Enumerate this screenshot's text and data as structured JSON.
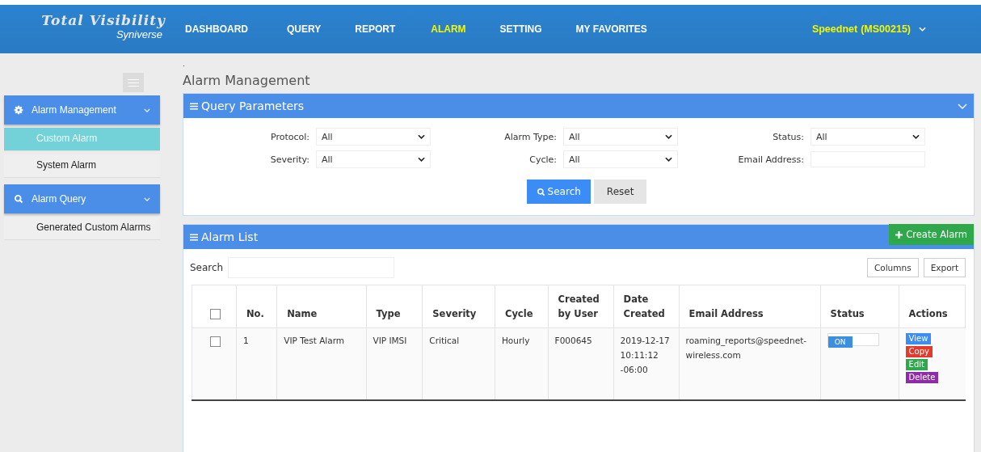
{
  "logo": {
    "title": "Total Visibility",
    "subtitle": "Syniverse"
  },
  "nav": [
    {
      "label": "DASHBOARD",
      "selected": false
    },
    {
      "label": "QUERY",
      "selected": false
    },
    {
      "label": "REPORT",
      "selected": false
    },
    {
      "label": "ALARM",
      "selected": true
    },
    {
      "label": "SETTING",
      "selected": false
    },
    {
      "label": "MY FAVORITES",
      "selected": false
    }
  ],
  "account": {
    "name": "Speednet",
    "code": "(MS00215)"
  },
  "sidebar": [
    {
      "label": "Alarm Management",
      "kind": "settings",
      "expanded": true,
      "children": [
        {
          "label": "Custom Alarm",
          "selected": true
        },
        {
          "label": "System Alarm",
          "selected": false
        }
      ]
    },
    {
      "label": "Alarm Query",
      "kind": "query",
      "expanded": true,
      "children": [
        {
          "label": "Generated Custom Alarms",
          "selected": false
        }
      ]
    }
  ],
  "breadcrumb": ".",
  "page_title": "Alarm Management",
  "query": {
    "title": "Query Parameters",
    "fields": [
      {
        "label": "Protocol:",
        "kind": "select",
        "value": "All"
      },
      {
        "label": "Alarm Type:",
        "kind": "select",
        "value": "All"
      },
      {
        "label": "Status:",
        "kind": "select",
        "value": "All"
      },
      {
        "label": "Severity:",
        "kind": "select",
        "value": "All"
      },
      {
        "label": "Cycle:",
        "kind": "select",
        "value": "All"
      },
      {
        "label": "Email Address:",
        "kind": "text"
      }
    ],
    "search_button": "Search",
    "reset_button": "Reset"
  },
  "alarm_list": {
    "title": "Alarm List",
    "create_button": "Create Alarm",
    "search_label": "Search",
    "columns_button": "Columns",
    "export_button": "Export",
    "all_checked": false,
    "columns": [
      "No.",
      "Name",
      "Type",
      "Severity",
      "Cycle",
      "Created by User",
      "Date Created",
      "Email Address",
      "Status",
      "Actions"
    ],
    "rows": [
      {
        "checked": false,
        "cells": [
          "1",
          "VIP Test Alarm",
          "VIP IMSI",
          "Critical",
          "Hourly",
          "F000645",
          "2019-12-17 10:11:12 -06:00",
          "roaming_reports@speednet-wireless.com"
        ],
        "status": {
          "label": "ON",
          "on": true
        },
        "actions": [
          {
            "label": "View",
            "kind": "view"
          },
          {
            "label": "Copy",
            "kind": "copy"
          },
          {
            "label": "Edit",
            "kind": "edit"
          },
          {
            "label": "Delete",
            "kind": "delete"
          }
        ]
      }
    ]
  }
}
